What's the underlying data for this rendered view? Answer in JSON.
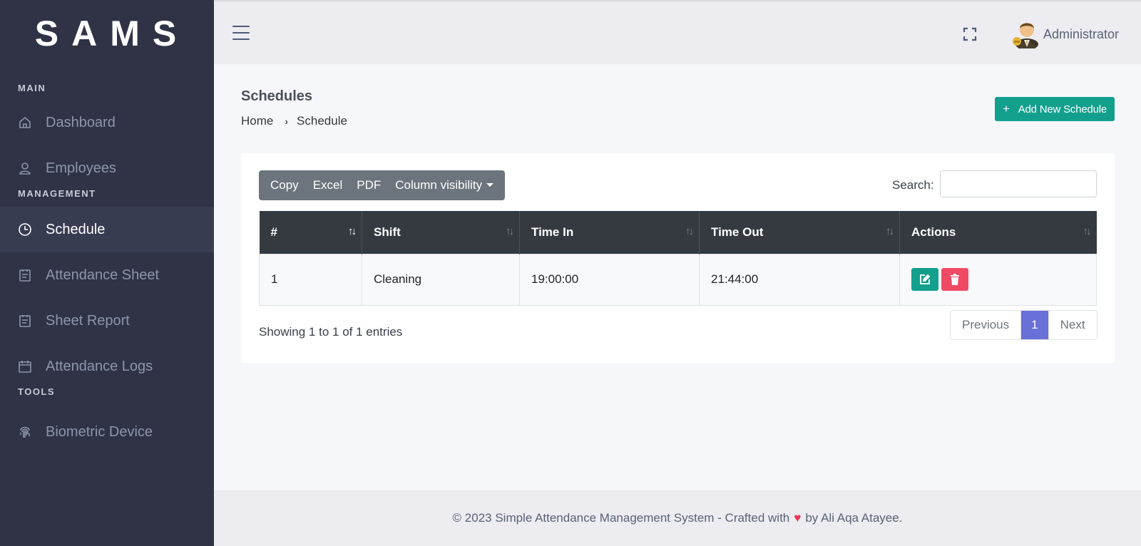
{
  "brand": "SAMS",
  "sidebar": {
    "sections": [
      {
        "title": "MAIN",
        "items": [
          {
            "label": "Dashboard",
            "icon": "home-icon"
          },
          {
            "label": "Employees",
            "icon": "user-icon"
          }
        ]
      },
      {
        "title": "MANAGEMENT",
        "items": [
          {
            "label": "Schedule",
            "icon": "clock-icon",
            "active": true
          },
          {
            "label": "Attendance Sheet",
            "icon": "clipboard-icon"
          },
          {
            "label": "Sheet Report",
            "icon": "clipboard-icon"
          },
          {
            "label": "Attendance Logs",
            "icon": "calendar-icon"
          }
        ]
      },
      {
        "title": "TOOLS",
        "items": [
          {
            "label": "Biometric Device",
            "icon": "fingerprint-icon"
          }
        ]
      }
    ]
  },
  "topbar": {
    "user_name": "Administrator",
    "menu_icon": "hamburger-icon",
    "fullscreen_icon": "fullscreen-icon"
  },
  "page": {
    "title": "Schedules",
    "breadcrumb": {
      "home": "Home",
      "current": "Schedule"
    },
    "add_button": "Add New Schedule"
  },
  "toolbar": {
    "copy": "Copy",
    "excel": "Excel",
    "pdf": "PDF",
    "column_visibility": "Column visibility",
    "search_label": "Search:",
    "search_value": ""
  },
  "table": {
    "headers": [
      "#",
      "Shift",
      "Time In",
      "Time Out",
      "Actions"
    ],
    "rows": [
      {
        "num": "1",
        "shift": "Cleaning",
        "time_in": "19:00:00",
        "time_out": "21:44:00"
      }
    ]
  },
  "pagination": {
    "info": "Showing 1 to 1 of 1 entries",
    "previous": "Previous",
    "current": "1",
    "next": "Next"
  },
  "footer": {
    "before": "© 2023 Simple Attendance Management System - Crafted with",
    "after": "by Ali Aqa Atayee."
  },
  "colors": {
    "sidebar_bg": "#2f3345",
    "accent_teal": "#12a08d",
    "danger": "#ef4a64",
    "page_active": "#6970d8",
    "table_header": "#343a40"
  }
}
